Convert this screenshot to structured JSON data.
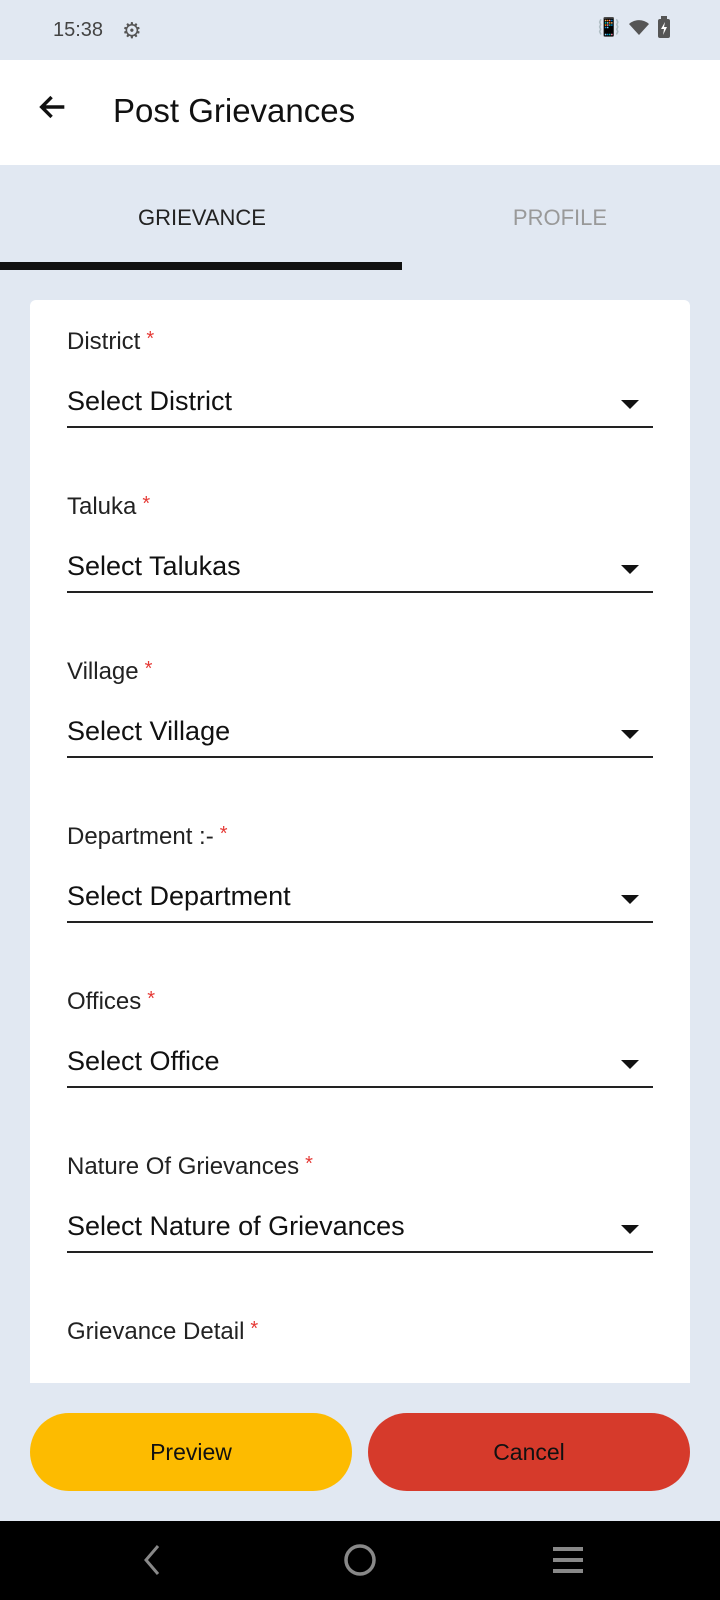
{
  "status_bar": {
    "time": "15:38",
    "icons": [
      "settings-gear-icon",
      "vibrate-icon",
      "wifi-icon",
      "battery-charging-icon"
    ]
  },
  "app_bar": {
    "title": "Post Grievances",
    "back_icon": "arrow-left-icon"
  },
  "tabs": [
    {
      "label": "GRIEVANCE",
      "active": true
    },
    {
      "label": "PROFILE",
      "active": false
    }
  ],
  "form": {
    "required_mark": "*",
    "fields": [
      {
        "label": "District",
        "value": "Select District"
      },
      {
        "label": "Taluka",
        "value": "Select Talukas"
      },
      {
        "label": "Village",
        "value": "Select Village"
      },
      {
        "label": "Department :-",
        "value": "Select Department"
      },
      {
        "label": "Offices",
        "value": "Select Office"
      },
      {
        "label": "Nature Of Grievances",
        "value": "Select Nature of Grievances"
      }
    ],
    "detail_label": "Grievance Detail"
  },
  "buttons": {
    "preview": "Preview",
    "cancel": "Cancel"
  },
  "colors": {
    "preview": "#fdbb00",
    "cancel": "#d63a2b",
    "required": "#e53935",
    "background": "#e1e8f2"
  },
  "nav_bar": {
    "icons": [
      "back-nav-icon",
      "home-nav-icon",
      "recents-nav-icon"
    ]
  }
}
